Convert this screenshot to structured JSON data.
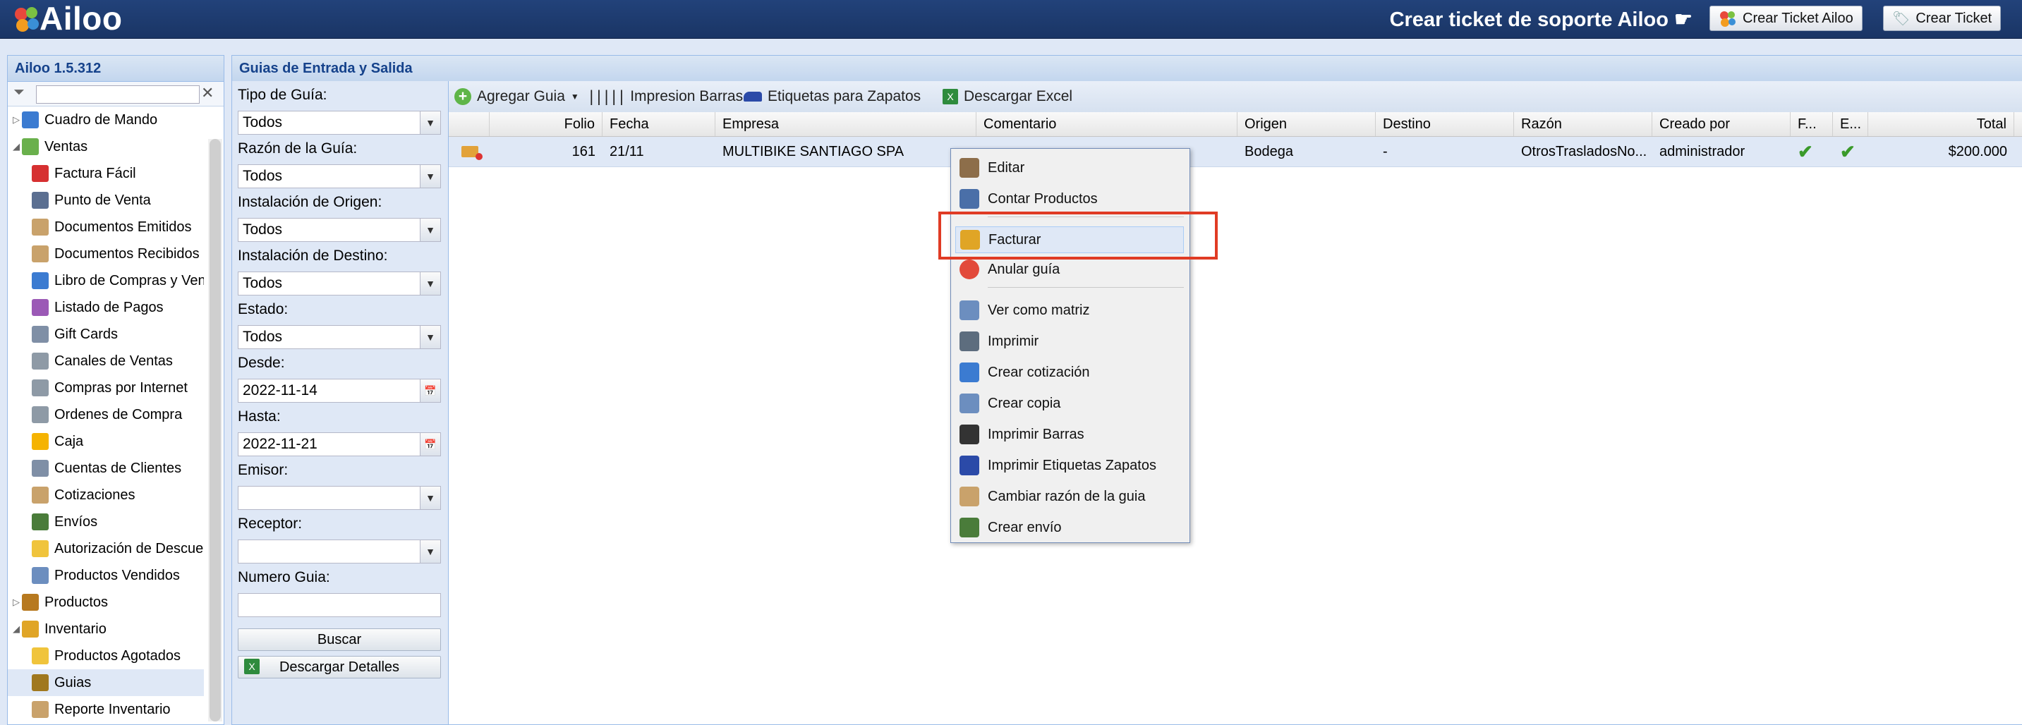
{
  "app": {
    "logo_text": "Ailoo",
    "version": "Ailoo 1.5.312"
  },
  "topbar": {
    "support_title": "Crear ticket de soporte Ailoo ☛",
    "btn_ticket_ailoo": "Crear Ticket Ailoo",
    "btn_ticket": "Crear Ticket"
  },
  "sidebar": {
    "filter_placeholder": "",
    "items": [
      {
        "label": "Cuadro de Mando",
        "icon": "chart-icon"
      },
      {
        "label": "Ventas",
        "icon": "money-icon"
      },
      {
        "label": "Factura Fácil",
        "icon": "ribbon-icon"
      },
      {
        "label": "Punto de Venta",
        "icon": "pos-icon"
      },
      {
        "label": "Documentos Emitidos",
        "icon": "document-icon"
      },
      {
        "label": "Documentos Recibidos",
        "icon": "document-icon"
      },
      {
        "label": "Libro de Compras y Ventas",
        "icon": "book-icon"
      },
      {
        "label": "Listado de Pagos",
        "icon": "payments-icon"
      },
      {
        "label": "Gift Cards",
        "icon": "card-icon"
      },
      {
        "label": "Canales de Ventas",
        "icon": "cart-icon"
      },
      {
        "label": "Compras por Internet",
        "icon": "cart-icon"
      },
      {
        "label": "Ordenes de Compra",
        "icon": "cart-icon"
      },
      {
        "label": "Caja",
        "icon": "coins-icon"
      },
      {
        "label": "Cuentas de Clientes",
        "icon": "card-icon"
      },
      {
        "label": "Cotizaciones",
        "icon": "document-icon"
      },
      {
        "label": "Envíos",
        "icon": "truck-icon"
      },
      {
        "label": "Autorización de Descuentos",
        "icon": "folder-icon"
      },
      {
        "label": "Productos Vendidos",
        "icon": "table-icon"
      },
      {
        "label": "Productos",
        "icon": "box-icon"
      },
      {
        "label": "Inventario",
        "icon": "cube-icon"
      },
      {
        "label": "Productos Agotados",
        "icon": "folder-icon"
      },
      {
        "label": "Guias",
        "icon": "guide-icon"
      },
      {
        "label": "Reporte Inventario",
        "icon": "document-icon"
      }
    ]
  },
  "main": {
    "title": "Guias de Entrada y Salida",
    "filters": {
      "tipo_label": "Tipo de Guía:",
      "tipo_value": "Todos",
      "razon_label": "Razón de la Guía:",
      "razon_value": "Todos",
      "origen_label": "Instalación de Origen:",
      "origen_value": "Todos",
      "destino_label": "Instalación de Destino:",
      "destino_value": "Todos",
      "estado_label": "Estado:",
      "estado_value": "Todos",
      "desde_label": "Desde:",
      "desde_value": "2022-11-14",
      "hasta_label": "Hasta:",
      "hasta_value": "2022-11-21",
      "emisor_label": "Emisor:",
      "emisor_value": "",
      "receptor_label": "Receptor:",
      "receptor_value": "",
      "numero_label": "Numero Guia:",
      "numero_value": "",
      "buscar_btn": "Buscar",
      "descargar_btn": "Descargar Detalles"
    },
    "toolbar": {
      "agregar": "Agregar Guia",
      "impresion": "Impresion Barras",
      "etiquetas": "Etiquetas para Zapatos",
      "excel": "Descargar Excel"
    },
    "grid": {
      "headers": [
        "Folio",
        "Fecha",
        "Empresa",
        "Comentario",
        "Origen",
        "Destino",
        "Razón",
        "Creado por",
        "F...",
        "E...",
        "Total"
      ],
      "row": {
        "folio": "161",
        "fecha": "21/11",
        "empresa": "MULTIBIKE SANTIAGO SPA",
        "comentario": "",
        "origen": "Bodega",
        "destino": "-",
        "razon": "OtrosTrasladosNo...",
        "creado_por": "administrador",
        "total": "$200.000"
      }
    }
  },
  "context_menu": {
    "items": [
      {
        "label": "Editar",
        "icon": "edit-icon"
      },
      {
        "label": "Contar Productos",
        "icon": "count-icon"
      },
      {
        "label": "Facturar",
        "icon": "invoice-box-icon"
      },
      {
        "label": "Anular guía",
        "icon": "cancel-icon"
      },
      {
        "label": "Ver como matriz",
        "icon": "matrix-icon"
      },
      {
        "label": "Imprimir",
        "icon": "printer-icon"
      },
      {
        "label": "Crear cotización",
        "icon": "quote-icon"
      },
      {
        "label": "Crear copia",
        "icon": "copy-icon"
      },
      {
        "label": "Imprimir Barras",
        "icon": "barcode-icon"
      },
      {
        "label": "Imprimir Etiquetas Zapatos",
        "icon": "shoe-icon"
      },
      {
        "label": "Cambiar razón de la guia",
        "icon": "edit-doc-icon"
      },
      {
        "label": "Crear envío",
        "icon": "truck-icon"
      }
    ]
  }
}
